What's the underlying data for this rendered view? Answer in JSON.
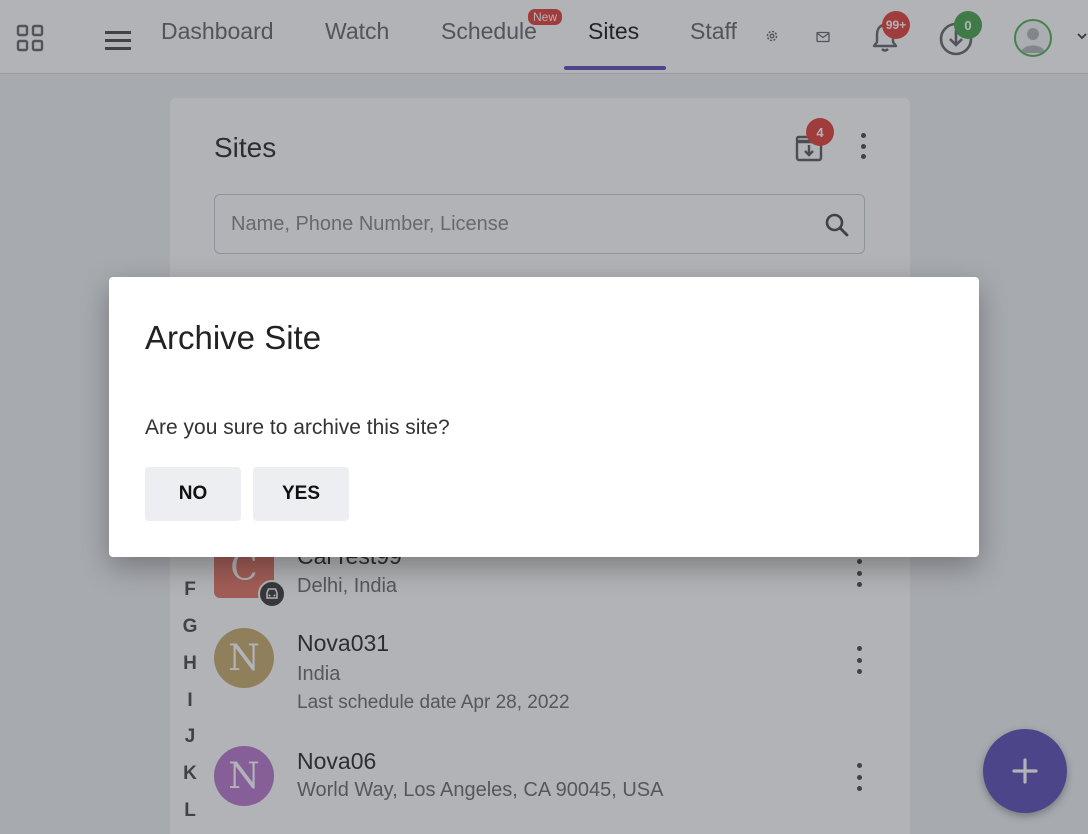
{
  "nav": {
    "tabs": [
      {
        "label": "Dashboard"
      },
      {
        "label": "Watch"
      },
      {
        "label": "Schedule",
        "badge": "New"
      },
      {
        "label": "Sites",
        "active": true
      },
      {
        "label": "Staff"
      }
    ],
    "notifications_count": "99+",
    "downloads_count": "0",
    "icons": [
      "apps-grid-icon",
      "menu-icon",
      "gear-icon",
      "mail-icon",
      "bell-icon",
      "download-icon",
      "avatar-icon",
      "chevron-down-icon"
    ]
  },
  "card": {
    "title": "Sites",
    "archive_badge": "4",
    "search_placeholder": "Name, Phone Number, License"
  },
  "alphabet": [
    "F",
    "G",
    "H",
    "I",
    "J",
    "K",
    "L"
  ],
  "sites": [
    {
      "initial": "C",
      "name": "CarTest99",
      "sub1": "Delhi, India",
      "color": "#e57060"
    },
    {
      "initial": "N",
      "name": "Nova031",
      "sub1": "India",
      "sub2": "Last schedule date Apr 28, 2022",
      "color": "#c8a868"
    },
    {
      "initial": "N",
      "name": "Nova06",
      "sub1": "World Way, Los Angeles, CA 90045, USA",
      "color": "#b774cf"
    }
  ],
  "dialog": {
    "title": "Archive Site",
    "message": "Are you sure to archive this site?",
    "no_label": "NO",
    "yes_label": "YES"
  },
  "colors": {
    "accent": "#5848b5",
    "badge_red": "#e53935",
    "badge_green": "#43a047"
  }
}
